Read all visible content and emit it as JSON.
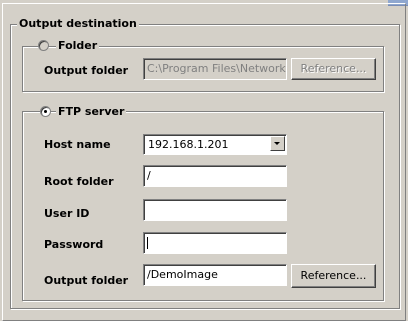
{
  "output_destination": {
    "title": "Output destination",
    "folder": {
      "radio_label": "Folder",
      "selected": false,
      "output_folder_label": "Output folder",
      "output_folder_value": "C:\\Program Files\\Network",
      "reference_label": "Reference..."
    },
    "ftp": {
      "radio_label": "FTP server",
      "selected": true,
      "host_label": "Host name",
      "host_value": "192.168.1.201",
      "root_label": "Root folder",
      "root_value": "/",
      "userid_label": "User ID",
      "userid_value": "",
      "password_label": "Password",
      "password_value": "",
      "output_folder_label": "Output folder",
      "output_folder_value": "/DemoImage",
      "reference_label": "Reference..."
    }
  },
  "icons": {
    "dropdown": "chevron-down-icon"
  },
  "colors": {
    "dialog_bg": "#d4d0c8",
    "disabled_text": "#808080"
  }
}
